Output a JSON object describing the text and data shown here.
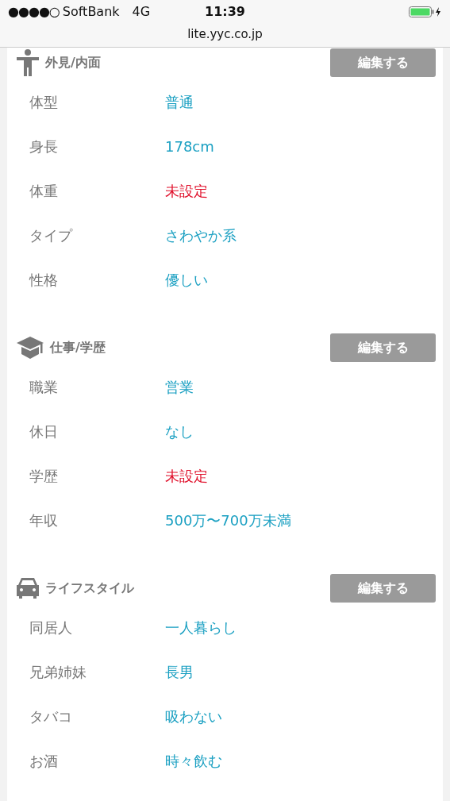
{
  "status_bar": {
    "signal": "●●●●○",
    "carrier": "SoftBank",
    "network": "4G",
    "time": "11:39"
  },
  "address_bar": {
    "url": "lite.yyc.co.jp"
  },
  "sections": [
    {
      "kind": "appearance",
      "title": "外見/内面",
      "button": "編集する",
      "rows": [
        {
          "label": "体型",
          "value": "普通",
          "unset": false
        },
        {
          "label": "身長",
          "value": "178cm",
          "unset": false
        },
        {
          "label": "体重",
          "value": "未設定",
          "unset": true
        },
        {
          "label": "タイプ",
          "value": "さわやか系",
          "unset": false
        },
        {
          "label": "性格",
          "value": "優しい",
          "unset": false
        }
      ]
    },
    {
      "kind": "work",
      "title": "仕事/学歴",
      "button": "編集する",
      "rows": [
        {
          "label": "職業",
          "value": "営業",
          "unset": false
        },
        {
          "label": "休日",
          "value": "なし",
          "unset": false
        },
        {
          "label": "学歴",
          "value": "未設定",
          "unset": true
        },
        {
          "label": "年収",
          "value": "500万〜700万未満",
          "unset": false
        }
      ]
    },
    {
      "kind": "lifestyle",
      "title": "ライフスタイル",
      "button": "編集する",
      "rows": [
        {
          "label": "同居人",
          "value": "一人暮らし",
          "unset": false
        },
        {
          "label": "兄弟姉妹",
          "value": "長男",
          "unset": false
        },
        {
          "label": "タバコ",
          "value": "吸わない",
          "unset": false
        },
        {
          "label": "お酒",
          "value": "時々飲む",
          "unset": false
        }
      ]
    }
  ]
}
